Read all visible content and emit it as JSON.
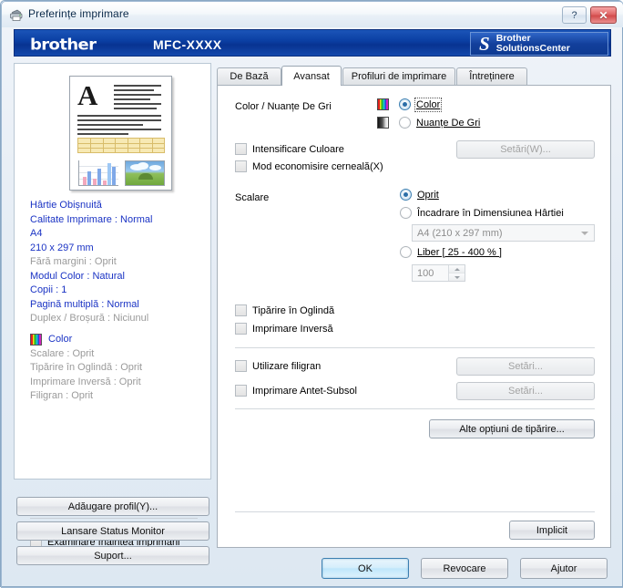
{
  "window": {
    "title": "Preferințe imprimare",
    "icon": "printer-icon",
    "help_label": "?",
    "close_label": "✕"
  },
  "banner": {
    "logo": "brother",
    "model": "MFC-XXXX",
    "solutions_s": "S",
    "solutions_line1": "Brother",
    "solutions_line2": "SolutionsCenter"
  },
  "preview": {
    "settings": [
      {
        "text": "Hârtie Obișnuită",
        "style": "blue"
      },
      {
        "text": "Calitate Imprimare : Normal",
        "style": "blue"
      },
      {
        "text": "A4",
        "style": "blue"
      },
      {
        "text": "210 x 297 mm",
        "style": "blue"
      },
      {
        "text": "Fără margini : Oprit",
        "style": "gray"
      },
      {
        "text": "Modul Color : Natural",
        "style": "blue"
      },
      {
        "text": "Copii : 1",
        "style": "blue"
      },
      {
        "text": "Pagină multiplă : Normal",
        "style": "blue"
      },
      {
        "text": "Duplex / Broșură : Niciunul",
        "style": "gray"
      }
    ],
    "color_mode_label": "Color",
    "color_mode_icon": "color-stripes-icon",
    "extra_settings": [
      {
        "text": "Scalare : Oprit",
        "style": "gray"
      },
      {
        "text": "Tipărire în Oglindă : Oprit",
        "style": "gray"
      },
      {
        "text": "Imprimare Inversă : Oprit",
        "style": "gray"
      },
      {
        "text": "Filigran : Oprit",
        "style": "gray"
      }
    ],
    "preview_checkbox_label": "Examinare înaintea imprimării",
    "preview_checkbox_checked": false
  },
  "left_buttons": {
    "add_profile": "Adăugare profil(Y)...",
    "status_monitor": "Lansare Status Monitor",
    "support": "Suport..."
  },
  "tabs": [
    {
      "label": "De Bază",
      "active": false
    },
    {
      "label": "Avansat",
      "active": true
    },
    {
      "label": "Profiluri de imprimare",
      "active": false
    },
    {
      "label": "Întreținere",
      "active": false
    }
  ],
  "advanced": {
    "color_group_label": "Color / Nuanțe De Gri",
    "color_option": {
      "label": "Color",
      "selected": true,
      "icon": "color-stripes-icon"
    },
    "grayscale_option": {
      "label": "Nuanțe De Gri",
      "selected": false,
      "icon": "grayscale-gradient-icon"
    },
    "color_enhance": {
      "label": "Intensificare Culoare",
      "checked": false
    },
    "color_enhance_settings_button": {
      "label": "Setări(W)...",
      "disabled": true
    },
    "ink_save": {
      "label": "Mod economisire cerneală(X)",
      "checked": false
    },
    "scaling_label": "Scalare",
    "scaling_options": [
      {
        "label": "Oprit",
        "selected": true
      },
      {
        "label": "Încadrare în Dimensiunea Hârtiei",
        "selected": false
      },
      {
        "label": "Liber [ 25 - 400 % ]",
        "selected": false
      }
    ],
    "paper_size_combo": {
      "value": "A4 (210 x 297 mm)",
      "disabled": true
    },
    "free_scale_spinner": {
      "value": "100",
      "disabled": true
    },
    "mirror_print": {
      "label": "Tipărire în Oglindă",
      "checked": false
    },
    "reverse_print": {
      "label": "Imprimare Inversă",
      "checked": false
    },
    "watermark": {
      "label": "Utilizare filigran",
      "checked": false
    },
    "watermark_settings_button": {
      "label": "Setări...",
      "disabled": true
    },
    "header_footer": {
      "label": "Imprimare Antet-Subsol",
      "checked": false
    },
    "header_footer_settings_button": {
      "label": "Setări...",
      "disabled": true
    },
    "other_print_options_button": {
      "label": "Alte opțiuni de tipărire..."
    },
    "default_button": {
      "label": "Implicit"
    }
  },
  "dialog_buttons": {
    "ok": "OK",
    "cancel": "Revocare",
    "help": "Ajutor"
  },
  "colors": {
    "banner_blue": "#0b3fa3",
    "link_blue": "#1a33c4",
    "disabled_gray": "#9a9a9a",
    "accent": "#3c7fb1"
  }
}
